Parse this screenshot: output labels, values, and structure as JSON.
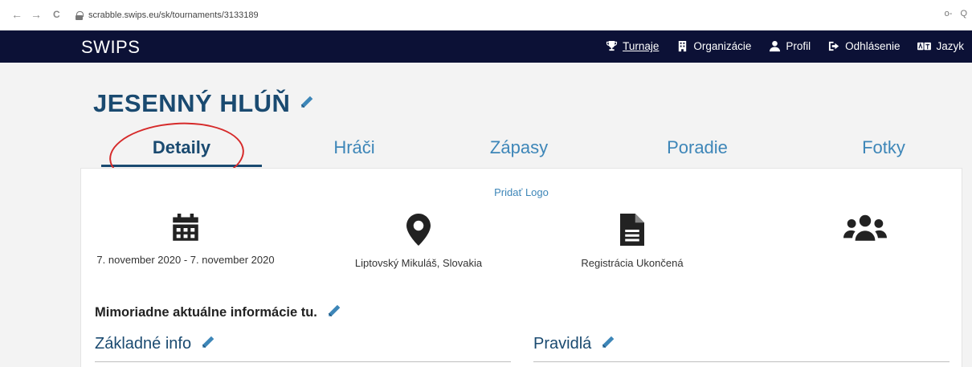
{
  "browser": {
    "back": "←",
    "forward": "→",
    "reload": "C",
    "url": "scrabble.swips.eu/sk/tournaments/3133189",
    "key_icon": "o-",
    "zoom_icon": "Q"
  },
  "navbar": {
    "brand": "SWIPS",
    "items": [
      {
        "label": "Turnaje",
        "icon": "trophy-icon",
        "active": true
      },
      {
        "label": "Organizácie",
        "icon": "building-icon"
      },
      {
        "label": "Profil",
        "icon": "user-icon"
      },
      {
        "label": "Odhlásenie",
        "icon": "logout-icon"
      },
      {
        "label": "Jazyk",
        "icon": "language-icon"
      }
    ]
  },
  "page": {
    "title": "JESENNÝ HLÚŇ",
    "tabs": [
      {
        "label": "Detaily",
        "active": true
      },
      {
        "label": "Hráči"
      },
      {
        "label": "Zápasy"
      },
      {
        "label": "Poradie"
      },
      {
        "label": "Fotky"
      }
    ],
    "add_logo": "Pridať Logo",
    "info": {
      "date": "7. november 2020 - 7. november 2020",
      "location": "Liptovský Mikuláš, Slovakia",
      "registration": "Registrácia Ukončená"
    },
    "extra_info": "Mimoriadne aktuálne informácie tu.",
    "sections": {
      "basic": "Základné info",
      "rules": "Pravidlá"
    }
  },
  "colors": {
    "navbar": "#0c1136",
    "title": "#1a4a70",
    "link": "#3d86b8",
    "annotation": "#d62a2a"
  }
}
